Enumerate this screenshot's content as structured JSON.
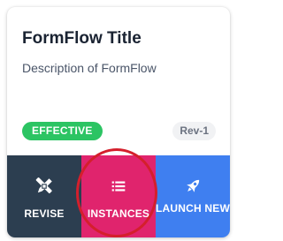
{
  "card": {
    "title": "FormFlow Title",
    "description": "Description of FormFlow",
    "status": "EFFECTIVE",
    "status_color": "#2cc463",
    "revision": "Rev-1"
  },
  "actions": [
    {
      "label": "REVISE",
      "icon": "edit-tools-icon",
      "color": "#2c3e50"
    },
    {
      "label": "INSTANCES",
      "icon": "list-icon",
      "color": "#e0246d"
    },
    {
      "label": "LAUNCH NEW",
      "icon": "rocket-icon",
      "color": "#3f7ff0"
    }
  ],
  "annotation": {
    "type": "highlight-circle",
    "color": "#d41f2c",
    "target": "instances-button"
  }
}
